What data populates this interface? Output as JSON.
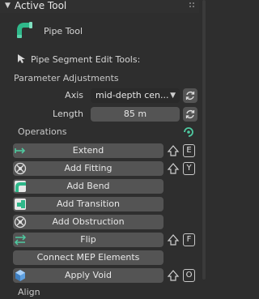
{
  "panel": {
    "title": "Active Tool",
    "tool_name": "Pipe Tool",
    "edit_tools_label": "Pipe Segment Edit Tools:"
  },
  "parameters": {
    "heading": "Parameter Adjustments",
    "axis_label": "Axis",
    "axis_value": "mid-depth cen...",
    "length_label": "Length",
    "length_value": "85 m"
  },
  "operations": {
    "heading": "Operations",
    "buttons": [
      {
        "label": "Extend",
        "hotkey": "E"
      },
      {
        "label": "Add Fitting",
        "hotkey": "Y"
      },
      {
        "label": "Add Bend"
      },
      {
        "label": "Add Transition"
      },
      {
        "label": "Add Obstruction"
      },
      {
        "label": "Flip",
        "hotkey": "F"
      },
      {
        "label": "Connect MEP Elements"
      },
      {
        "label": "Apply Void",
        "hotkey": "O"
      }
    ]
  },
  "next_section": "Align",
  "colors": {
    "background": "#2e2e2e",
    "button": "#545454",
    "dropdown": "#2a2a2a",
    "accent_green": "#4fc9a0"
  }
}
